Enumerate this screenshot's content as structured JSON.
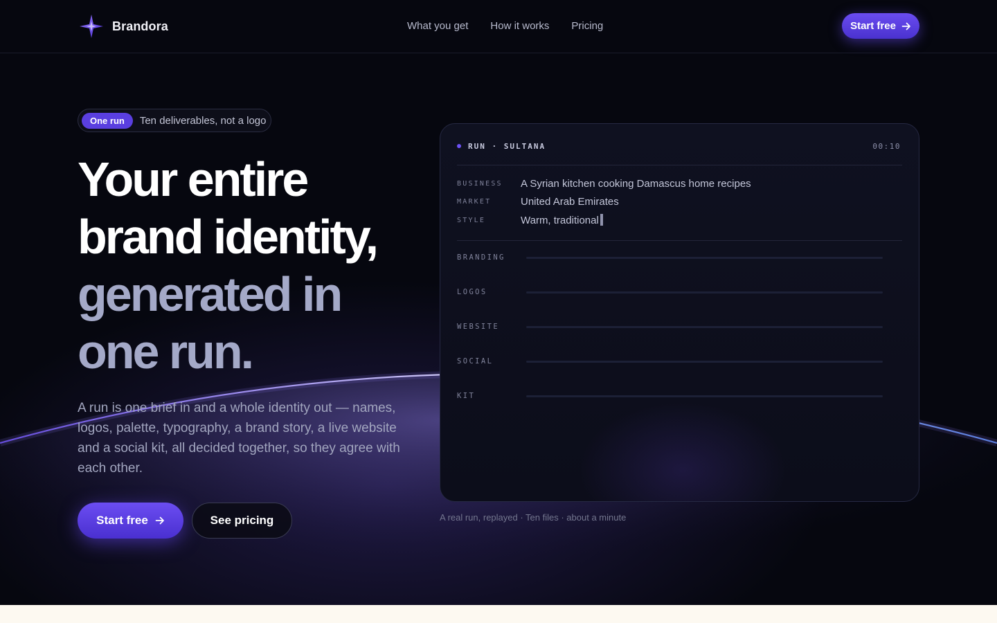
{
  "nav": {
    "brand": "Brandora",
    "links": [
      "What you get",
      "How it works",
      "Pricing"
    ],
    "cta_label": "Start free"
  },
  "hero": {
    "pill_badge": "One run",
    "pill_text": "Ten deliverables, not a logo",
    "headline_lines": [
      "Your entire",
      "brand identity,",
      "generated in",
      "one run."
    ],
    "subtext": "A run is one brief in and a whole identity out — names, logos, palette, typography, a brand story, a live website and a social kit, all decided together, so they agree with each other.",
    "primary_cta": "Start free",
    "secondary_cta": "See pricing"
  },
  "run_panel": {
    "label": "RUN · SULTANA",
    "timer": "00:10",
    "brief": [
      {
        "key": "BUSINESS",
        "value": "A Syrian kitchen cooking Damascus home recipes"
      },
      {
        "key": "MARKET",
        "value": "United Arab Emirates"
      },
      {
        "key": "STYLE",
        "value": "Warm, traditional"
      }
    ],
    "tracks": [
      "BRANDING",
      "LOGOS",
      "WEBSITE",
      "SOCIAL",
      "KIT"
    ],
    "caption": "A real run, replayed · Ten files · about a minute"
  },
  "colors": {
    "accent": "#5a3fe0",
    "background": "#06070f",
    "headline_dim": "#a4a9c8",
    "footer_strip": "#fdf9f1"
  },
  "icons": {
    "logo": "four-point-star-icon",
    "cta": "arrow-right-icon"
  }
}
